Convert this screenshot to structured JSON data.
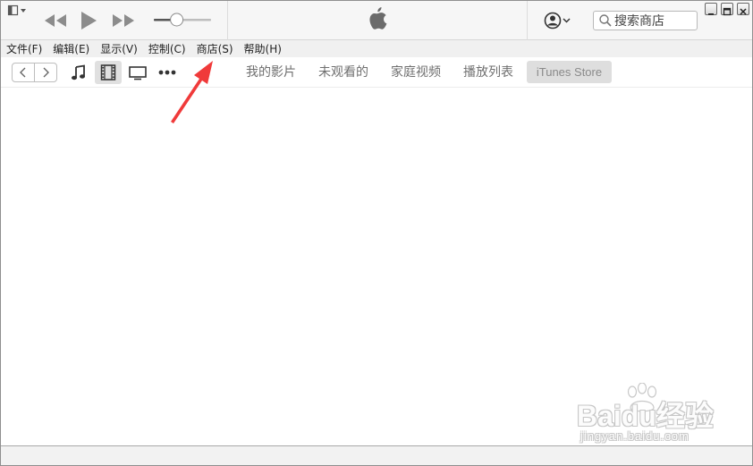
{
  "app": {
    "name": "iTunes"
  },
  "player": {
    "icons": [
      "sidebar-toggle-icon",
      "rewind-icon",
      "play-icon",
      "fast-forward-icon",
      "volume-slider",
      "apple-logo-icon",
      "account-icon"
    ],
    "volume_level": 0.4
  },
  "search": {
    "placeholder": "搜索商店",
    "icon": "magnifier-icon"
  },
  "window_controls": [
    "minimize",
    "maximize",
    "close"
  ],
  "menu": {
    "items": [
      {
        "label": "文件(F)"
      },
      {
        "label": "编辑(E)"
      },
      {
        "label": "显示(V)"
      },
      {
        "label": "控制(C)"
      },
      {
        "label": "商店(S)"
      },
      {
        "label": "帮助(H)"
      }
    ]
  },
  "nav": {
    "back_icon": "chevron-left-icon",
    "forward_icon": "chevron-right-icon",
    "media_types": [
      {
        "icon": "music-note-icon",
        "selected": false
      },
      {
        "icon": "film-icon",
        "selected": true
      },
      {
        "icon": "tv-icon",
        "selected": false
      },
      {
        "icon": "more-icon",
        "selected": false
      }
    ],
    "tabs": [
      {
        "label": "我的影片"
      },
      {
        "label": "未观看的"
      },
      {
        "label": "家庭视频"
      },
      {
        "label": "播放列表"
      },
      {
        "label": "iTunes Store",
        "selected": true
      }
    ]
  },
  "annotation": {
    "type": "red-arrow",
    "points_to": "商店(S)",
    "color": "#f03a3a"
  },
  "watermark": {
    "brand": "Baidu经验",
    "url": "jingyan.baidu.com"
  },
  "colors": {
    "arrow": "#f03a3a",
    "selected_tab_bg": "#dedede",
    "icon_gray": "#8c8c8c"
  }
}
